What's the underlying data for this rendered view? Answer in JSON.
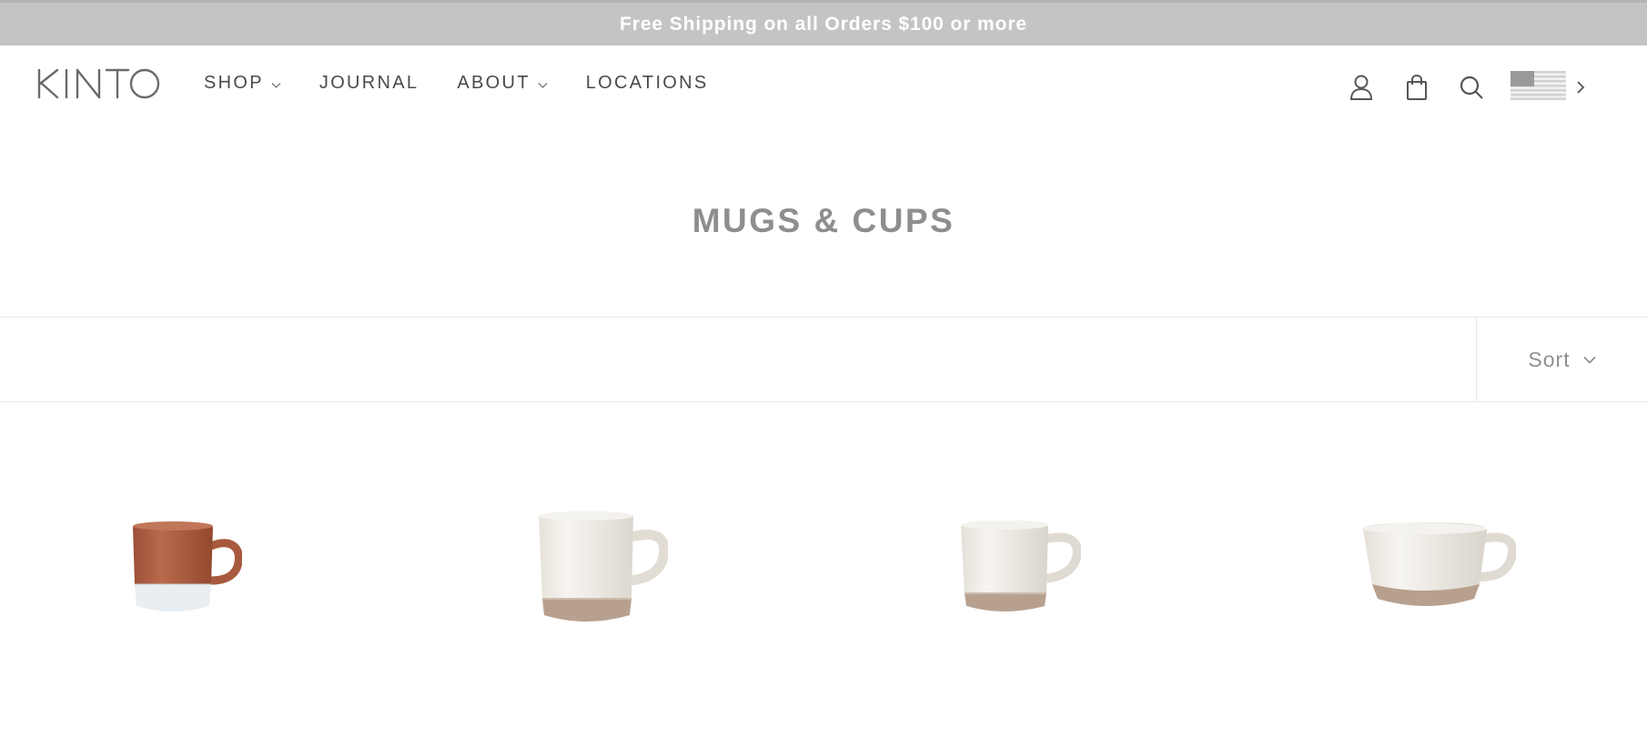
{
  "announcement": {
    "text": "Free Shipping on all Orders $100 or more"
  },
  "header": {
    "logo_text": "KINTO",
    "nav": [
      {
        "label": "SHOP",
        "has_dropdown": true
      },
      {
        "label": "JOURNAL",
        "has_dropdown": false
      },
      {
        "label": "ABOUT",
        "has_dropdown": true
      },
      {
        "label": "LOCATIONS",
        "has_dropdown": false
      }
    ],
    "icons": [
      "account-icon",
      "cart-icon",
      "search-icon",
      "us-flag-icon",
      "chevron-right-icon"
    ]
  },
  "collection": {
    "title": "MUGS & CUPS"
  },
  "toolbar": {
    "sort_label": "Sort"
  },
  "products": [
    {
      "name": "terracotta-stacking-mug"
    },
    {
      "name": "white-tall-mug"
    },
    {
      "name": "white-small-mug"
    },
    {
      "name": "white-wide-cup"
    }
  ],
  "colors": {
    "announcement_bg": "#c4c4c4",
    "text_gray": "#8e8e8e",
    "nav_text": "#4a4a4a",
    "terracotta": "#b0654a",
    "clay_base": "#b8a08e"
  }
}
